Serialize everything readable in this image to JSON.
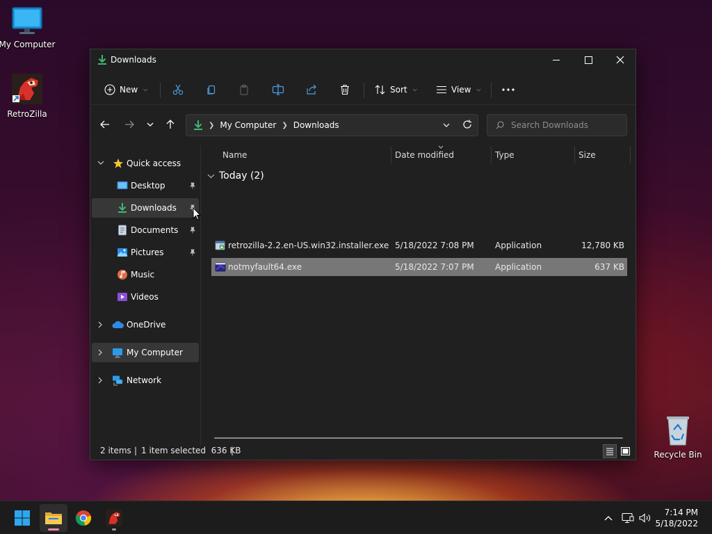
{
  "desktop": {
    "icons": [
      {
        "label": "My Computer"
      },
      {
        "label": "RetroZilla"
      },
      {
        "label": "Recycle Bin"
      }
    ]
  },
  "window": {
    "title": "Downloads",
    "toolbar": {
      "new_label": "New",
      "sort_label": "Sort",
      "view_label": "View"
    },
    "address": {
      "segments": [
        "My Computer",
        "Downloads"
      ]
    },
    "search": {
      "placeholder": "Search Downloads"
    },
    "nav": {
      "quick_access": "Quick access",
      "items": [
        {
          "label": "Desktop",
          "pinned": true
        },
        {
          "label": "Downloads",
          "pinned": true,
          "selected": true
        },
        {
          "label": "Documents",
          "pinned": true
        },
        {
          "label": "Pictures",
          "pinned": true
        },
        {
          "label": "Music",
          "pinned": false
        },
        {
          "label": "Videos",
          "pinned": false
        }
      ],
      "onedrive": "OneDrive",
      "my_computer": "My Computer",
      "network": "Network"
    },
    "columns": {
      "name": "Name",
      "date": "Date modified",
      "type": "Type",
      "size": "Size"
    },
    "group": "Today (2)",
    "files": [
      {
        "name": "retrozilla-2.2.en-US.win32.installer.exe",
        "date": "5/18/2022 7:08 PM",
        "type": "Application",
        "size": "12,780 KB",
        "selected": false
      },
      {
        "name": "notmyfault64.exe",
        "date": "5/18/2022 7:07 PM",
        "type": "Application",
        "size": "637 KB",
        "selected": true
      }
    ],
    "status": {
      "items": "2 items",
      "selection": "1 item selected  636 KB"
    }
  },
  "taskbar": {
    "time": "7:14 PM",
    "date": "5/18/2022"
  },
  "colors": {
    "window_bg": "#202020",
    "selected_row": "#777777",
    "accent_green": "#3fb874",
    "folder_yellow": "#f2c14e"
  }
}
